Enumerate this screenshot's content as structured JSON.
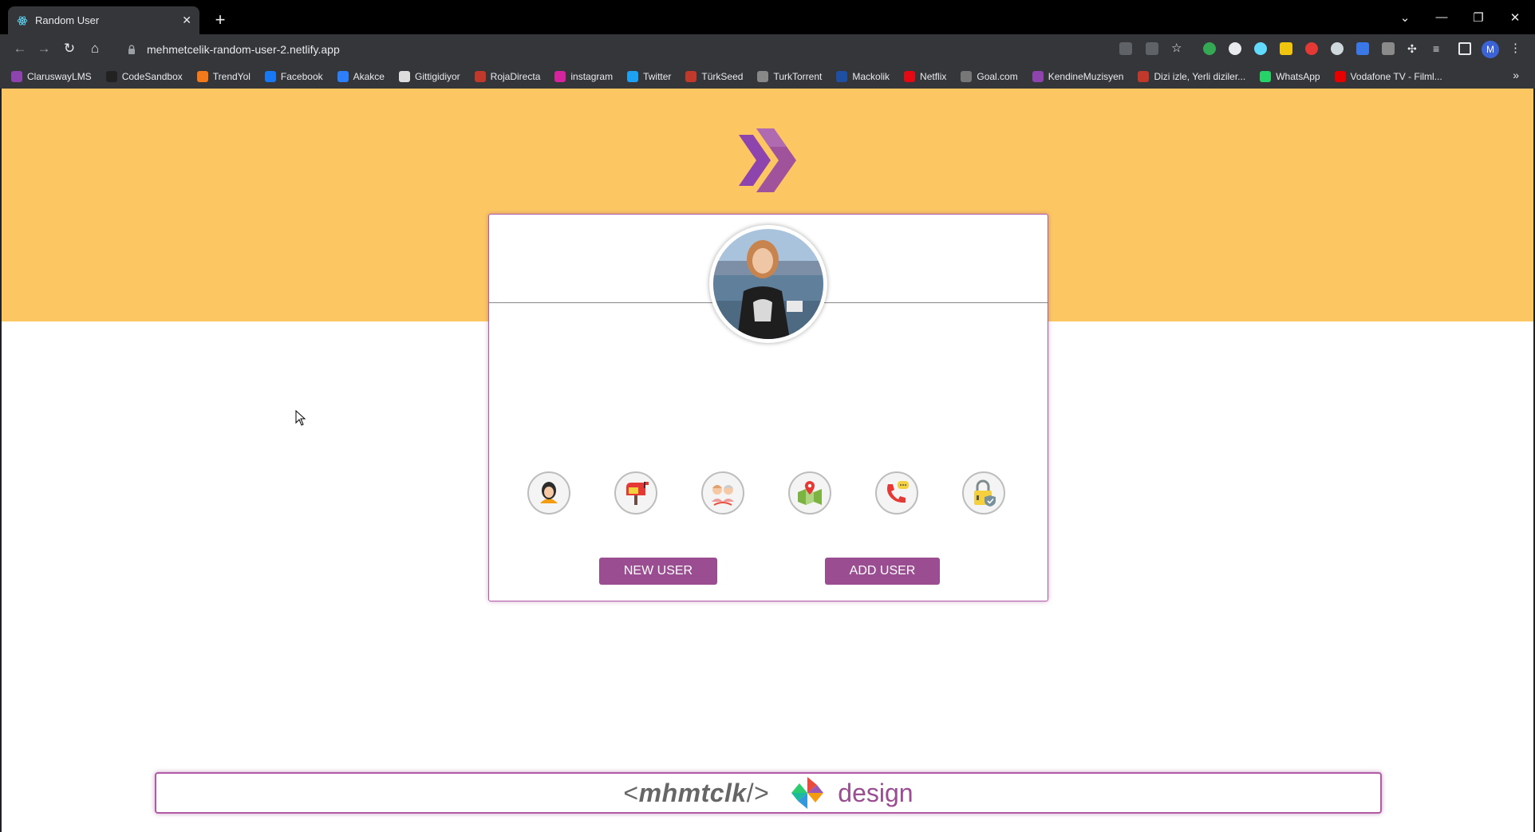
{
  "browser": {
    "tab_title": "Random User",
    "tab_close": "✕",
    "new_tab": "+",
    "url": "mehmetcelik-random-user-2.netlify.app",
    "profile_initial": "M",
    "window_controls": [
      "⌄",
      "—",
      "❐",
      "✕"
    ],
    "bookmarks_more": "»",
    "bookmarks": [
      {
        "label": "ClaruswayLMS",
        "color": "#8e44ad"
      },
      {
        "label": "CodeSandbox",
        "color": "#222222"
      },
      {
        "label": "TrendYol",
        "color": "#f27a1a"
      },
      {
        "label": "Facebook",
        "color": "#1877f2"
      },
      {
        "label": "Akakce",
        "color": "#2d7ff9"
      },
      {
        "label": "Gittigidiyor",
        "color": "#dddddd"
      },
      {
        "label": "RojaDirecta",
        "color": "#c0392b"
      },
      {
        "label": "instagram",
        "color": "#d6249f"
      },
      {
        "label": "Twitter",
        "color": "#1da1f2"
      },
      {
        "label": "TürkSeed",
        "color": "#c0392b"
      },
      {
        "label": "TurkTorrent",
        "color": "#888888"
      },
      {
        "label": "Mackolik",
        "color": "#1e4fa3"
      },
      {
        "label": "Netflix",
        "color": "#e50914"
      },
      {
        "label": "Goal.com",
        "color": "#777777"
      },
      {
        "label": "KendineMuzisyen",
        "color": "#8e44ad"
      },
      {
        "label": "Dizi izle, Yerli diziler...",
        "color": "#c0392b"
      },
      {
        "label": "WhatsApp",
        "color": "#25d366"
      },
      {
        "label": "Vodafone TV - Filml...",
        "color": "#e60000"
      }
    ]
  },
  "card": {
    "title_line": "",
    "value_line": "",
    "icons": [
      "person-icon",
      "mailbox-icon",
      "age-icon",
      "map-icon",
      "phone-icon",
      "lock-icon"
    ],
    "new_user_label": "NEW USER",
    "add_user_label": "ADD USER"
  },
  "footer": {
    "open": "<",
    "name": "mhmtclk",
    "close": "/>",
    "design": "design"
  },
  "colors": {
    "hero": "#fcc762",
    "accent": "#9a4d91",
    "border": "#b25aa5"
  }
}
